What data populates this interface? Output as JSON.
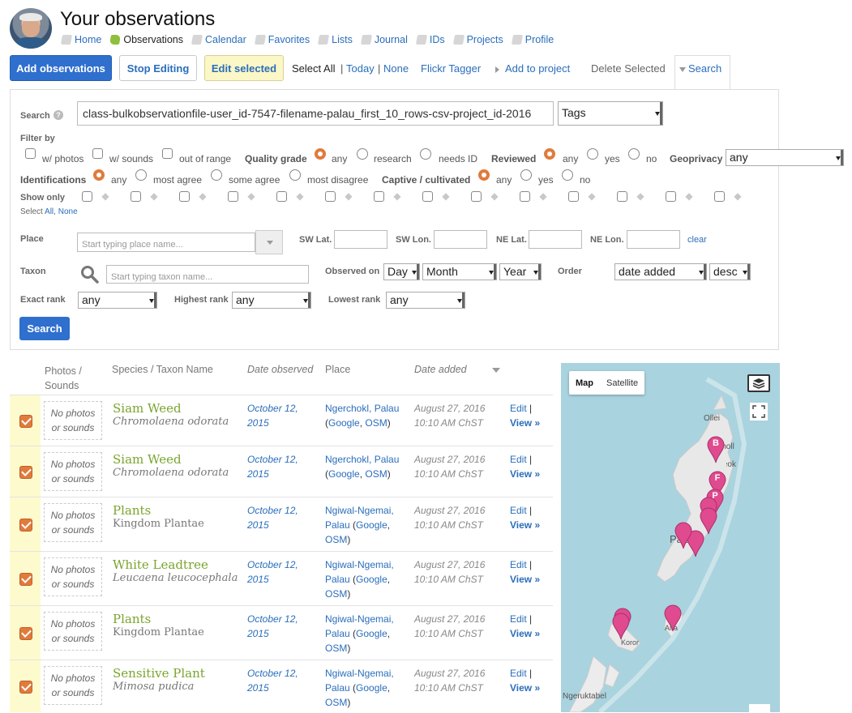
{
  "header": {
    "title": "Your observations",
    "nav": [
      {
        "label": "Home",
        "icon": "home-icon"
      },
      {
        "label": "Observations",
        "icon": "observations-icon"
      },
      {
        "label": "Calendar",
        "icon": "calendar-icon"
      },
      {
        "label": "Favorites",
        "icon": "favorites-icon"
      },
      {
        "label": "Lists",
        "icon": "lists-icon"
      },
      {
        "label": "Journal",
        "icon": "journal-icon"
      },
      {
        "label": "IDs",
        "icon": "ids-icon"
      },
      {
        "label": "Projects",
        "icon": "projects-icon"
      },
      {
        "label": "Profile",
        "icon": "profile-icon"
      }
    ]
  },
  "toolbar": {
    "add_label": "Add observations",
    "stop_label": "Stop Editing",
    "edit_selected_label": "Edit selected",
    "select_label": "Select",
    "all_label": "All",
    "sep": "|",
    "today_label": "Today",
    "none_label": "None",
    "flickr_label": "Flickr Tagger",
    "add_project_label": "Add to project",
    "delete_label": "Delete Selected",
    "search_tab_label": "Search"
  },
  "search": {
    "search_label": "Search",
    "query_value": "class-bulkobservationfile-user_id-7547-filename-palau_first_10_rows-csv-project_id-2016",
    "field_select": "Tags",
    "filter_by_label": "Filter by",
    "photos_label": "w/ photos",
    "sounds_label": "w/ sounds",
    "out_of_range_label": "out of range",
    "quality_grade_label": "Quality grade",
    "quality_options": [
      "any",
      "research",
      "needs ID"
    ],
    "reviewed_label": "Reviewed",
    "reviewed_options": [
      "any",
      "yes",
      "no"
    ],
    "geoprivacy_label": "Geoprivacy",
    "geoprivacy_value": "any",
    "identifications_label": "Identifications",
    "identification_options": [
      "any",
      "most agree",
      "some agree",
      "most disagree"
    ],
    "captive_label": "Captive / cultivated",
    "captive_options": [
      "any",
      "yes",
      "no"
    ],
    "show_only_label": "Show only",
    "iconic_taxa": [
      "plants-icon",
      "plantae-leaf-icon",
      "mollusca-icon",
      "aves-icon",
      "amphibia-icon",
      "reptilia-icon",
      "mammalia-icon",
      "actinopterygii-icon",
      "arachnida-icon",
      "insecta-icon",
      "fungi-icon",
      "protozoa-icon",
      "chromista-icon",
      "unknown-icon"
    ],
    "select_all_prefix": "Select",
    "select_all_label": "All",
    "select_none_label": "None",
    "place_label": "Place",
    "place_placeholder": "Start typing place name...",
    "sw_lat_label": "SW Lat.",
    "sw_lon_label": "SW Lon.",
    "ne_lat_label": "NE Lat.",
    "ne_lon_label": "NE Lon.",
    "clear_label": "clear",
    "taxon_label": "Taxon",
    "taxon_placeholder": "Start typing taxon name...",
    "observed_on_label": "Observed on",
    "day_value": "Day",
    "month_value": "Month",
    "year_value": "Year",
    "order_label": "Order",
    "order_value": "date added",
    "direction_value": "desc",
    "exact_rank_label": "Exact rank",
    "exact_rank_value": "any",
    "highest_rank_label": "Highest rank",
    "highest_rank_value": "any",
    "lowest_rank_label": "Lowest rank",
    "lowest_rank_value": "any",
    "submit_label": "Search"
  },
  "table": {
    "headers": {
      "photos": "Photos /",
      "sounds": "Sounds",
      "species": "Species / Taxon Name",
      "date_observed": "Date observed",
      "place": "Place",
      "date_added": "Date added"
    },
    "rows": [
      {
        "photo_line1": "No photos",
        "photo_line2": "or sounds",
        "common": "Siam Weed",
        "sci": "Chromolaena odorata",
        "date1": "October 12,",
        "date2": "2015",
        "place_name": "Ngerchokl, Palau",
        "google": "Google",
        "osm": "OSM",
        "added1": "August 27, 2016",
        "added2": "10:10 AM ChST",
        "edit": "Edit",
        "view": "View »"
      },
      {
        "photo_line1": "No photos",
        "photo_line2": "or sounds",
        "common": "Siam Weed",
        "sci": "Chromolaena odorata",
        "date1": "October 12,",
        "date2": "2015",
        "place_name": "Ngerchokl, Palau",
        "google": "Google",
        "osm": "OSM",
        "added1": "August 27, 2016",
        "added2": "10:10 AM ChST",
        "edit": "Edit",
        "view": "View »"
      },
      {
        "photo_line1": "No photos",
        "photo_line2": "or sounds",
        "common": "Plants",
        "sci": "Kingdom Plantae",
        "date1": "October 12,",
        "date2": "2015",
        "place_name": "Ngiwal-Ngemai, Palau",
        "google": "Google",
        "osm": "OSM",
        "added1": "August 27, 2016",
        "added2": "10:10 AM ChST",
        "edit": "Edit",
        "view": "View »"
      },
      {
        "photo_line1": "No photos",
        "photo_line2": "or sounds",
        "common": "White Leadtree",
        "sci": "Leucaena leucocephala",
        "date1": "October 12,",
        "date2": "2015",
        "place_name": "Ngiwal-Ngemai, Palau",
        "google": "Google",
        "osm": "OSM",
        "added1": "August 27, 2016",
        "added2": "10:10 AM ChST",
        "edit": "Edit",
        "view": "View »"
      },
      {
        "photo_line1": "No photos",
        "photo_line2": "or sounds",
        "common": "Plants",
        "sci": "Kingdom Plantae",
        "date1": "October 12,",
        "date2": "2015",
        "place_name": "Ngiwal-Ngemai, Palau",
        "google": "Google",
        "osm": "OSM",
        "added1": "August 27, 2016",
        "added2": "10:10 AM ChST",
        "edit": "Edit",
        "view": "View »"
      },
      {
        "photo_line1": "No photos",
        "photo_line2": "or sounds",
        "common": "Sensitive Plant",
        "sci": "Mimosa pudica",
        "date1": "October 12,",
        "date2": "2015",
        "place_name": "Ngiwal-Ngemai, Palau",
        "google": "Google",
        "osm": "OSM",
        "added1": "August 27, 2016",
        "added2": "10:10 AM ChST",
        "edit": "Edit",
        "view": "View »"
      }
    ]
  },
  "map": {
    "map_label": "Map",
    "satellite_label": "Satellite",
    "place_labels": [
      "Ollei",
      "Choll",
      "Melekeok",
      "Palau",
      "Koror",
      "Airai",
      "Ngeruktabel"
    ],
    "marker_labels": [
      "B",
      "F",
      "P"
    ],
    "marker_color": "#e04a8f"
  },
  "colors": {
    "accent": "#2f6fce",
    "radio_on": "#e07b3c",
    "common_name": "#7aa52d",
    "edit_selected_bg": "#fbf7c6"
  }
}
